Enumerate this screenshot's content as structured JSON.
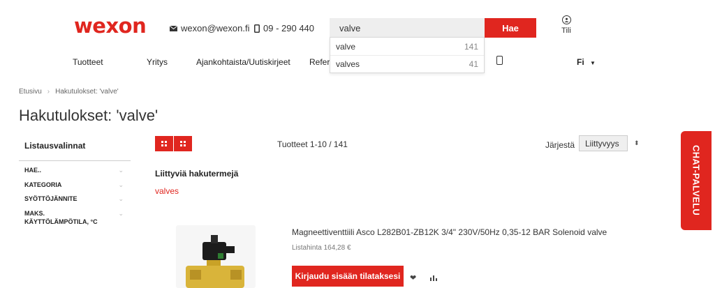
{
  "header": {
    "logo": "wexon",
    "email": "wexon@wexon.fi",
    "phone": "09 - 290 440",
    "search_value": "valve",
    "search_button": "Hae",
    "account_label": "Tili",
    "account_icon": "user-circle-icon"
  },
  "search_suggestions": [
    {
      "term": "valve",
      "count": "141"
    },
    {
      "term": "valves",
      "count": "41"
    }
  ],
  "nav": {
    "items": [
      "Tuotteet",
      "Yritys",
      "Ajankohtaista/Uutiskirjeet",
      "Refer"
    ],
    "language": "Fi"
  },
  "breadcrumb": {
    "home": "Etusivu",
    "current": "Hakutulokset: 'valve'"
  },
  "page_title": "Hakutulokset: 'valve'",
  "filters": {
    "title": "Listausvalinnat",
    "items": [
      "HAE..",
      "KATEGORIA",
      "SYÖTTÖJÄNNITE",
      "MAKS. KÄYTTÖLÄMPÖTILA, °C"
    ]
  },
  "results": {
    "count_text": "Tuotteet 1-10 / 141",
    "sort_label": "Järjestä",
    "sort_value": "Liittyvyys"
  },
  "related": {
    "title": "Liittyviä hakutermejä",
    "terms": [
      "valves"
    ]
  },
  "product": {
    "name": "Magneettiventtiili Asco L282B01-ZB12K 3/4\" 230V/50Hz 0,35-12 BAR Solenoid valve",
    "price": "Listahinta 164,28 €",
    "login_button": "Kirjaudu sisään tilataksesi"
  },
  "chat_tab": "CHAT-PALVELU",
  "colors": {
    "accent": "#e0261f"
  }
}
